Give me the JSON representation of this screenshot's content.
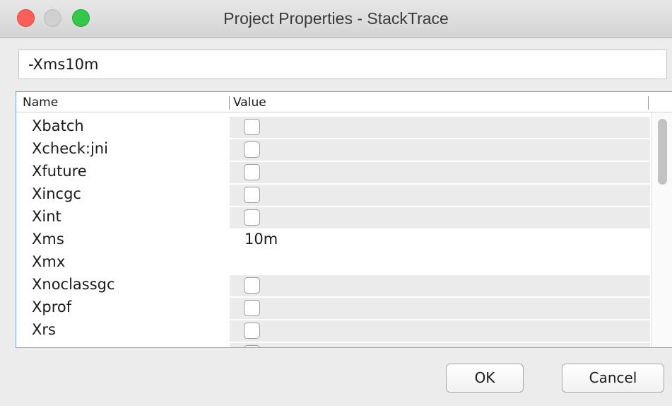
{
  "window": {
    "title": "Project Properties - StackTrace"
  },
  "args_input": {
    "value": "-Xms10m"
  },
  "table": {
    "columns": [
      "Name",
      "Value"
    ],
    "rows": [
      {
        "name": "Xbatch",
        "type": "checkbox",
        "checked": false
      },
      {
        "name": "Xcheck:jni",
        "type": "checkbox",
        "checked": false
      },
      {
        "name": "Xfuture",
        "type": "checkbox",
        "checked": false
      },
      {
        "name": "Xincgc",
        "type": "checkbox",
        "checked": false
      },
      {
        "name": "Xint",
        "type": "checkbox",
        "checked": false
      },
      {
        "name": "Xms",
        "type": "text",
        "value": "10m"
      },
      {
        "name": "Xmx",
        "type": "text",
        "value": ""
      },
      {
        "name": "Xnoclassgc",
        "type": "checkbox",
        "checked": false
      },
      {
        "name": "Xprof",
        "type": "checkbox",
        "checked": false
      },
      {
        "name": "Xrs",
        "type": "checkbox",
        "checked": false
      }
    ]
  },
  "buttons": {
    "ok_label": "OK",
    "cancel_label": "Cancel"
  }
}
